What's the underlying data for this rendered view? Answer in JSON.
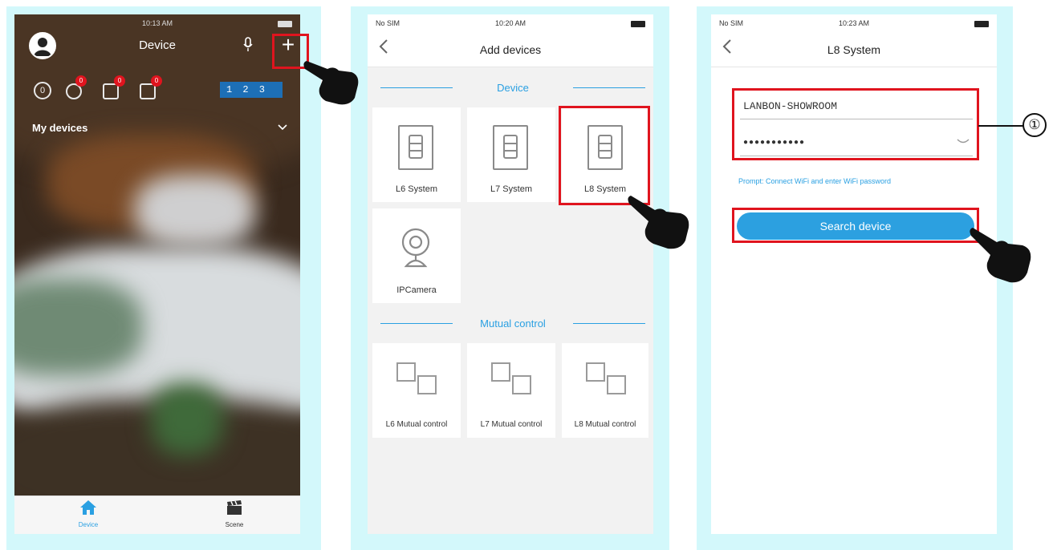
{
  "colors": {
    "frame": "#d3f8fb",
    "highlight": "#e0141e",
    "accent": "#2aa0e2",
    "button": "#2ca0e0"
  },
  "phone1": {
    "status_time": "10:13 AM",
    "title": "Device",
    "icons": [
      "user-icon",
      "microphone-icon",
      "plus-icon"
    ],
    "status_badges": [
      "0",
      "0",
      "0"
    ],
    "digital_display": "1 2 3",
    "section_label": "My devices",
    "tabs": [
      {
        "label": "Device",
        "icon": "home-icon",
        "active": true
      },
      {
        "label": "Scene",
        "icon": "clapperboard-icon",
        "active": false
      }
    ]
  },
  "phone2": {
    "status_carrier": "No SIM",
    "status_time": "10:20 AM",
    "title": "Add devices",
    "device_section": "Device",
    "devices": [
      {
        "label": "L6 System",
        "icon": "panel-icon"
      },
      {
        "label": "L7 System",
        "icon": "panel-icon"
      },
      {
        "label": "L8 System",
        "icon": "panel-icon"
      },
      {
        "label": "IPCamera",
        "icon": "camera-icon"
      }
    ],
    "mutual_section": "Mutual control",
    "mutual": [
      {
        "label": "L6 Mutual control"
      },
      {
        "label": "L7 Mutual control"
      },
      {
        "label": "L8 Mutual control"
      }
    ]
  },
  "phone3": {
    "status_carrier": "No SIM",
    "status_time": "10:23 AM",
    "title": "L8 System",
    "wifi_name": "LANBON-SHOWROOM",
    "wifi_password": "●●●●●●●●●●●",
    "hint": "Prompt: Connect WiFi and enter WiFi password",
    "search_button": "Search device",
    "callout": "①"
  }
}
